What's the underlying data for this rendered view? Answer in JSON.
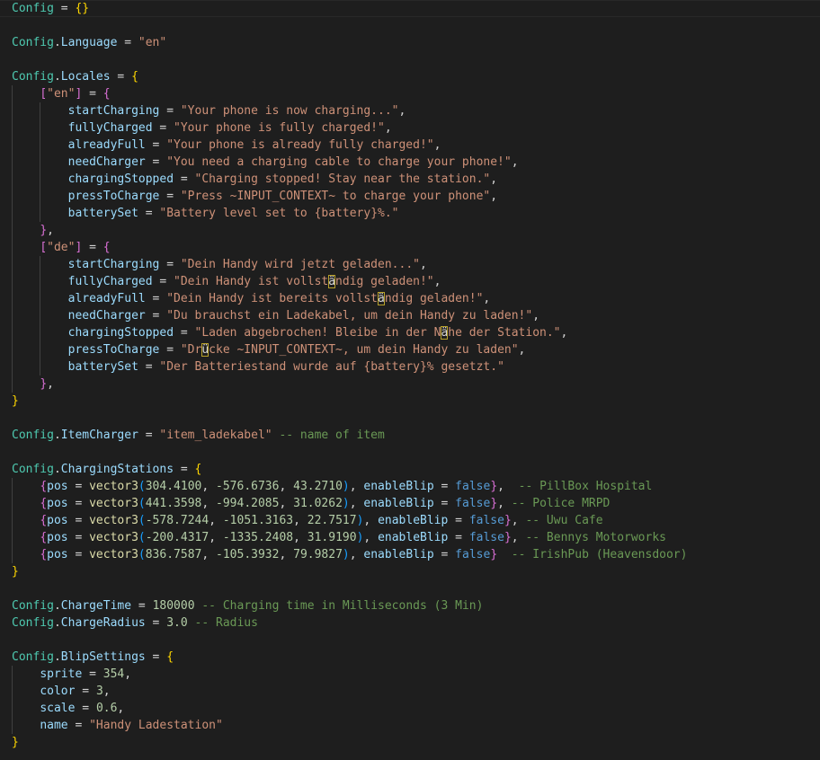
{
  "editor": {
    "language": "lua",
    "theme": "dark",
    "background_color": "#1e1e1e"
  },
  "colors": {
    "global_table": "#4ec9b0",
    "property": "#9cdcfe",
    "string": "#ce9178",
    "number": "#b5cea8",
    "keyword": "#569cd6",
    "function": "#dcdcaa",
    "comment": "#6a9955",
    "bracket_level1": "#ffd700",
    "bracket_level2": "#da70d6",
    "bracket_level3": "#179fff"
  },
  "lines": [
    [
      [
        "cfg",
        "Config"
      ],
      [
        "op",
        " = "
      ],
      [
        "br1",
        "{}"
      ]
    ],
    [],
    [
      [
        "cfg",
        "Config"
      ],
      [
        "op",
        "."
      ],
      [
        "prop",
        "Language"
      ],
      [
        "op",
        " = "
      ],
      [
        "str",
        "\"en\""
      ]
    ],
    [],
    [
      [
        "cfg",
        "Config"
      ],
      [
        "op",
        "."
      ],
      [
        "prop",
        "Locales"
      ],
      [
        "op",
        " = "
      ],
      [
        "br1",
        "{"
      ]
    ],
    [
      [
        "op",
        "    "
      ],
      [
        "br2",
        "["
      ],
      [
        "str",
        "\"en\""
      ],
      [
        "br2",
        "]"
      ],
      [
        "op",
        " = "
      ],
      [
        "br2",
        "{"
      ]
    ],
    [
      [
        "op",
        "        "
      ],
      [
        "prop",
        "startCharging"
      ],
      [
        "op",
        " = "
      ],
      [
        "str",
        "\"Your phone is now charging...\""
      ],
      [
        "op",
        ","
      ]
    ],
    [
      [
        "op",
        "        "
      ],
      [
        "prop",
        "fullyCharged"
      ],
      [
        "op",
        " = "
      ],
      [
        "str",
        "\"Your phone is fully charged!\""
      ],
      [
        "op",
        ","
      ]
    ],
    [
      [
        "op",
        "        "
      ],
      [
        "prop",
        "alreadyFull"
      ],
      [
        "op",
        " = "
      ],
      [
        "str",
        "\"Your phone is already fully charged!\""
      ],
      [
        "op",
        ","
      ]
    ],
    [
      [
        "op",
        "        "
      ],
      [
        "prop",
        "needCharger"
      ],
      [
        "op",
        " = "
      ],
      [
        "str",
        "\"You need a charging cable to charge your phone!\""
      ],
      [
        "op",
        ","
      ]
    ],
    [
      [
        "op",
        "        "
      ],
      [
        "prop",
        "chargingStopped"
      ],
      [
        "op",
        " = "
      ],
      [
        "str",
        "\"Charging stopped! Stay near the station.\""
      ],
      [
        "op",
        ","
      ]
    ],
    [
      [
        "op",
        "        "
      ],
      [
        "prop",
        "pressToCharge"
      ],
      [
        "op",
        " = "
      ],
      [
        "str",
        "\"Press ~INPUT_CONTEXT~ to charge your phone\""
      ],
      [
        "op",
        ","
      ]
    ],
    [
      [
        "op",
        "        "
      ],
      [
        "prop",
        "batterySet"
      ],
      [
        "op",
        " = "
      ],
      [
        "str",
        "\"Battery level set to {battery}%.\""
      ]
    ],
    [
      [
        "op",
        "    "
      ],
      [
        "br2",
        "}"
      ],
      [
        "op",
        ","
      ]
    ],
    [
      [
        "op",
        "    "
      ],
      [
        "br2",
        "["
      ],
      [
        "str",
        "\"de\""
      ],
      [
        "br2",
        "]"
      ],
      [
        "op",
        " = "
      ],
      [
        "br2",
        "{"
      ]
    ],
    [
      [
        "op",
        "        "
      ],
      [
        "prop",
        "startCharging"
      ],
      [
        "op",
        " = "
      ],
      [
        "str",
        "\"Dein Handy wird jetzt geladen...\""
      ],
      [
        "op",
        ","
      ]
    ],
    [
      [
        "op",
        "        "
      ],
      [
        "prop",
        "fullyCharged"
      ],
      [
        "op",
        " = "
      ],
      [
        "str",
        "\"Dein Handy ist vollst"
      ],
      [
        "hl",
        "ä"
      ],
      [
        "str",
        "ndig geladen!\""
      ],
      [
        "op",
        ","
      ]
    ],
    [
      [
        "op",
        "        "
      ],
      [
        "prop",
        "alreadyFull"
      ],
      [
        "op",
        " = "
      ],
      [
        "str",
        "\"Dein Handy ist bereits vollst"
      ],
      [
        "hl",
        "ä"
      ],
      [
        "str",
        "ndig geladen!\""
      ],
      [
        "op",
        ","
      ]
    ],
    [
      [
        "op",
        "        "
      ],
      [
        "prop",
        "needCharger"
      ],
      [
        "op",
        " = "
      ],
      [
        "str",
        "\"Du brauchst ein Ladekabel, um dein Handy zu laden!\""
      ],
      [
        "op",
        ","
      ]
    ],
    [
      [
        "op",
        "        "
      ],
      [
        "prop",
        "chargingStopped"
      ],
      [
        "op",
        " = "
      ],
      [
        "str",
        "\"Laden abgebrochen! Bleibe in der N"
      ],
      [
        "hl",
        "ä"
      ],
      [
        "str",
        "he der Station.\""
      ],
      [
        "op",
        ","
      ]
    ],
    [
      [
        "op",
        "        "
      ],
      [
        "prop",
        "pressToCharge"
      ],
      [
        "op",
        " = "
      ],
      [
        "str",
        "\"Dr"
      ],
      [
        "hl",
        "ü"
      ],
      [
        "str",
        "cke ~INPUT_CONTEXT~, um dein Handy zu laden\""
      ],
      [
        "op",
        ","
      ]
    ],
    [
      [
        "op",
        "        "
      ],
      [
        "prop",
        "batterySet"
      ],
      [
        "op",
        " = "
      ],
      [
        "str",
        "\"Der Batteriestand wurde auf {battery}% gesetzt.\""
      ]
    ],
    [
      [
        "op",
        "    "
      ],
      [
        "br2",
        "}"
      ],
      [
        "op",
        ","
      ]
    ],
    [
      [
        "br1",
        "}"
      ]
    ],
    [],
    [
      [
        "cfg",
        "Config"
      ],
      [
        "op",
        "."
      ],
      [
        "prop",
        "ItemCharger"
      ],
      [
        "op",
        " = "
      ],
      [
        "str",
        "\"item_ladekabel\""
      ],
      [
        "op",
        " "
      ],
      [
        "cmt",
        "-- name of item"
      ]
    ],
    [],
    [
      [
        "cfg",
        "Config"
      ],
      [
        "op",
        "."
      ],
      [
        "prop",
        "ChargingStations"
      ],
      [
        "op",
        " = "
      ],
      [
        "br1",
        "{"
      ]
    ],
    [
      [
        "op",
        "    "
      ],
      [
        "br2",
        "{"
      ],
      [
        "prop",
        "pos"
      ],
      [
        "op",
        " = "
      ],
      [
        "fn",
        "vector3"
      ],
      [
        "br3",
        "("
      ],
      [
        "num",
        "304.4100"
      ],
      [
        "op",
        ", "
      ],
      [
        "num",
        "-576.6736"
      ],
      [
        "op",
        ", "
      ],
      [
        "num",
        "43.2710"
      ],
      [
        "br3",
        ")"
      ],
      [
        "op",
        ", "
      ],
      [
        "prop",
        "enableBlip"
      ],
      [
        "op",
        " = "
      ],
      [
        "kw",
        "false"
      ],
      [
        "br2",
        "}"
      ],
      [
        "op",
        ",  "
      ],
      [
        "cmt",
        "-- PillBox Hospital"
      ]
    ],
    [
      [
        "op",
        "    "
      ],
      [
        "br2",
        "{"
      ],
      [
        "prop",
        "pos"
      ],
      [
        "op",
        " = "
      ],
      [
        "fn",
        "vector3"
      ],
      [
        "br3",
        "("
      ],
      [
        "num",
        "441.3598"
      ],
      [
        "op",
        ", "
      ],
      [
        "num",
        "-994.2085"
      ],
      [
        "op",
        ", "
      ],
      [
        "num",
        "31.0262"
      ],
      [
        "br3",
        ")"
      ],
      [
        "op",
        ", "
      ],
      [
        "prop",
        "enableBlip"
      ],
      [
        "op",
        " = "
      ],
      [
        "kw",
        "false"
      ],
      [
        "br2",
        "}"
      ],
      [
        "op",
        ", "
      ],
      [
        "cmt",
        "-- Police MRPD"
      ]
    ],
    [
      [
        "op",
        "    "
      ],
      [
        "br2",
        "{"
      ],
      [
        "prop",
        "pos"
      ],
      [
        "op",
        " = "
      ],
      [
        "fn",
        "vector3"
      ],
      [
        "br3",
        "("
      ],
      [
        "num",
        "-578.7244"
      ],
      [
        "op",
        ", "
      ],
      [
        "num",
        "-1051.3163"
      ],
      [
        "op",
        ", "
      ],
      [
        "num",
        "22.7517"
      ],
      [
        "br3",
        ")"
      ],
      [
        "op",
        ", "
      ],
      [
        "prop",
        "enableBlip"
      ],
      [
        "op",
        " = "
      ],
      [
        "kw",
        "false"
      ],
      [
        "br2",
        "}"
      ],
      [
        "op",
        ", "
      ],
      [
        "cmt",
        "-- Uwu Cafe"
      ]
    ],
    [
      [
        "op",
        "    "
      ],
      [
        "br2",
        "{"
      ],
      [
        "prop",
        "pos"
      ],
      [
        "op",
        " = "
      ],
      [
        "fn",
        "vector3"
      ],
      [
        "br3",
        "("
      ],
      [
        "num",
        "-200.4317"
      ],
      [
        "op",
        ", "
      ],
      [
        "num",
        "-1335.2408"
      ],
      [
        "op",
        ", "
      ],
      [
        "num",
        "31.9190"
      ],
      [
        "br3",
        ")"
      ],
      [
        "op",
        ", "
      ],
      [
        "prop",
        "enableBlip"
      ],
      [
        "op",
        " = "
      ],
      [
        "kw",
        "false"
      ],
      [
        "br2",
        "}"
      ],
      [
        "op",
        ", "
      ],
      [
        "cmt",
        "-- Bennys Motorworks"
      ]
    ],
    [
      [
        "op",
        "    "
      ],
      [
        "br2",
        "{"
      ],
      [
        "prop",
        "pos"
      ],
      [
        "op",
        " = "
      ],
      [
        "fn",
        "vector3"
      ],
      [
        "br3",
        "("
      ],
      [
        "num",
        "836.7587"
      ],
      [
        "op",
        ", "
      ],
      [
        "num",
        "-105.3932"
      ],
      [
        "op",
        ", "
      ],
      [
        "num",
        "79.9827"
      ],
      [
        "br3",
        ")"
      ],
      [
        "op",
        ", "
      ],
      [
        "prop",
        "enableBlip"
      ],
      [
        "op",
        " = "
      ],
      [
        "kw",
        "false"
      ],
      [
        "br2",
        "}"
      ],
      [
        "op",
        "  "
      ],
      [
        "cmt",
        "-- IrishPub (Heavensdoor)"
      ]
    ],
    [
      [
        "br1",
        "}"
      ]
    ],
    [],
    [
      [
        "cfg",
        "Config"
      ],
      [
        "op",
        "."
      ],
      [
        "prop",
        "ChargeTime"
      ],
      [
        "op",
        " = "
      ],
      [
        "num",
        "180000"
      ],
      [
        "op",
        " "
      ],
      [
        "cmt",
        "-- Charging time in Milliseconds (3 Min)"
      ]
    ],
    [
      [
        "cfg",
        "Config"
      ],
      [
        "op",
        "."
      ],
      [
        "prop",
        "ChargeRadius"
      ],
      [
        "op",
        " = "
      ],
      [
        "num",
        "3.0"
      ],
      [
        "op",
        " "
      ],
      [
        "cmt",
        "-- Radius"
      ]
    ],
    [],
    [
      [
        "cfg",
        "Config"
      ],
      [
        "op",
        "."
      ],
      [
        "prop",
        "BlipSettings"
      ],
      [
        "op",
        " = "
      ],
      [
        "br1",
        "{"
      ]
    ],
    [
      [
        "op",
        "    "
      ],
      [
        "prop",
        "sprite"
      ],
      [
        "op",
        " = "
      ],
      [
        "num",
        "354"
      ],
      [
        "op",
        ","
      ]
    ],
    [
      [
        "op",
        "    "
      ],
      [
        "prop",
        "color"
      ],
      [
        "op",
        " = "
      ],
      [
        "num",
        "3"
      ],
      [
        "op",
        ","
      ]
    ],
    [
      [
        "op",
        "    "
      ],
      [
        "prop",
        "scale"
      ],
      [
        "op",
        " = "
      ],
      [
        "num",
        "0.6"
      ],
      [
        "op",
        ","
      ]
    ],
    [
      [
        "op",
        "    "
      ],
      [
        "prop",
        "name"
      ],
      [
        "op",
        " = "
      ],
      [
        "str",
        "\"Handy Ladestation\""
      ]
    ],
    [
      [
        "br1",
        "}"
      ]
    ]
  ]
}
